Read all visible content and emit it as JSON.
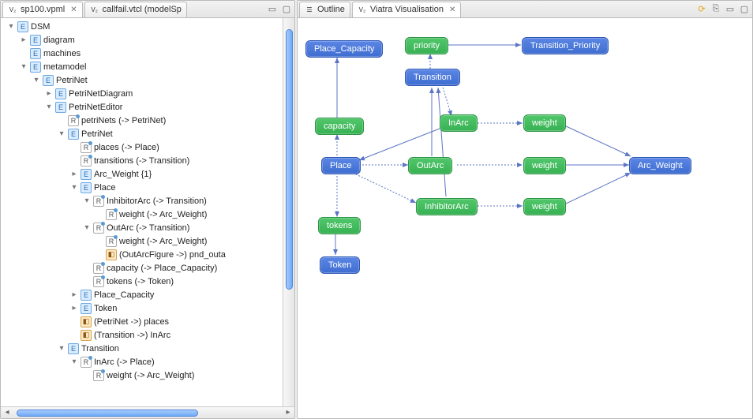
{
  "leftPanel": {
    "tabs": [
      {
        "label": "sp100.vpml",
        "active": true,
        "closable": true,
        "icon": "V2"
      },
      {
        "label": "callfail.vtcl (modelSp",
        "active": false,
        "closable": false,
        "icon": "V2"
      }
    ],
    "tree": {
      "root": "DSM",
      "diagram": "diagram",
      "machines": "machines",
      "metamodel": "metamodel",
      "petrinet_top": "PetriNet",
      "petrinetdiagram": "PetriNetDiagram",
      "petrineteditor": "PetriNetEditor",
      "petriNets_ref": "petriNets (-> PetriNet)",
      "petrinet": "PetriNet",
      "places_ref": "places (-> Place)",
      "transitions_ref": "transitions (-> Transition)",
      "arc_weight1": "Arc_Weight {1}",
      "place": "Place",
      "inhibitor_arc": "InhibitorArc (-> Transition)",
      "inh_weight": "weight (-> Arc_Weight)",
      "out_arc": "OutArc (-> Transition)",
      "out_weight": "weight (-> Arc_Weight)",
      "out_fig": "(OutArcFigure ->) pnd_outa",
      "capacity": "capacity (-> Place_Capacity)",
      "tokens": "tokens (-> Token)",
      "place_capacity": "Place_Capacity",
      "token": "Token",
      "petrinet_places": "(PetriNet ->) places",
      "transition_inarc": "(Transition ->) InArc",
      "transition": "Transition",
      "inarc": "InArc (-> Place)",
      "inarc_weight": "weight (-> Arc_Weight)"
    }
  },
  "rightPanel": {
    "tabs": [
      {
        "label": "Outline",
        "active": false,
        "icon": "outline"
      },
      {
        "label": "Viatra Visualisation",
        "active": true,
        "closable": true,
        "icon": "V2"
      }
    ],
    "nodes": {
      "place_capacity": "Place_Capacity",
      "priority": "priority",
      "transition_priority": "Transition_Priority",
      "transition": "Transition",
      "capacity": "capacity",
      "inarc": "InArc",
      "weight1": "weight",
      "place": "Place",
      "outarc": "OutArc",
      "weight2": "weight",
      "arc_weight": "Arc_Weight",
      "inhibitor": "InhibitorArc",
      "weight3": "weight",
      "tokens": "tokens",
      "token": "Token"
    }
  }
}
